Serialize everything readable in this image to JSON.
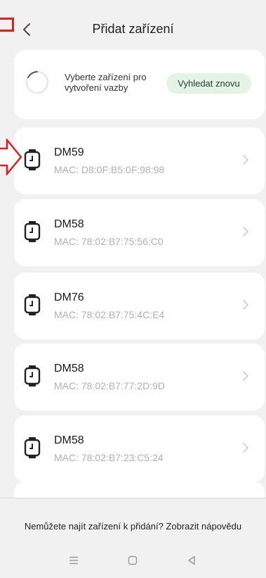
{
  "header": {
    "title": "Přidat zařízení"
  },
  "scan": {
    "text": "Vyberte zařízení pro vytvoření vazby",
    "button_label": "Vyhledat znovu",
    "button_color": "#e3f4e5"
  },
  "devices": [
    {
      "name": "DM59",
      "mac": "MAC: D8:0F:B5:0F:98:98",
      "icon": "smartwatch-icon"
    },
    {
      "name": "DM58",
      "mac": "MAC: 78:02:B7:75:56:C0",
      "icon": "smartwatch-icon"
    },
    {
      "name": "DM76",
      "mac": "MAC: 78:02:B7:75:4C:E4",
      "icon": "smartwatch-icon"
    },
    {
      "name": "DM58",
      "mac": "MAC: 78:02:B7:77:2D:9D",
      "icon": "smartwatch-icon"
    },
    {
      "name": "DM58",
      "mac": "MAC: 78:02:B7:23:C5:24",
      "icon": "smartwatch-icon"
    }
  ],
  "footer": {
    "help_text": "Nemůžete najít zařízení k přidání? Zobrazit nápovědu"
  },
  "nav_bar": {
    "icons": [
      "menu-icon",
      "home-icon",
      "back-triangle-icon"
    ]
  },
  "colors": {
    "background": "#f1f1f1",
    "card": "#ffffff",
    "annotation": "#e01f1f",
    "mac_text": "#b1b1b1"
  }
}
